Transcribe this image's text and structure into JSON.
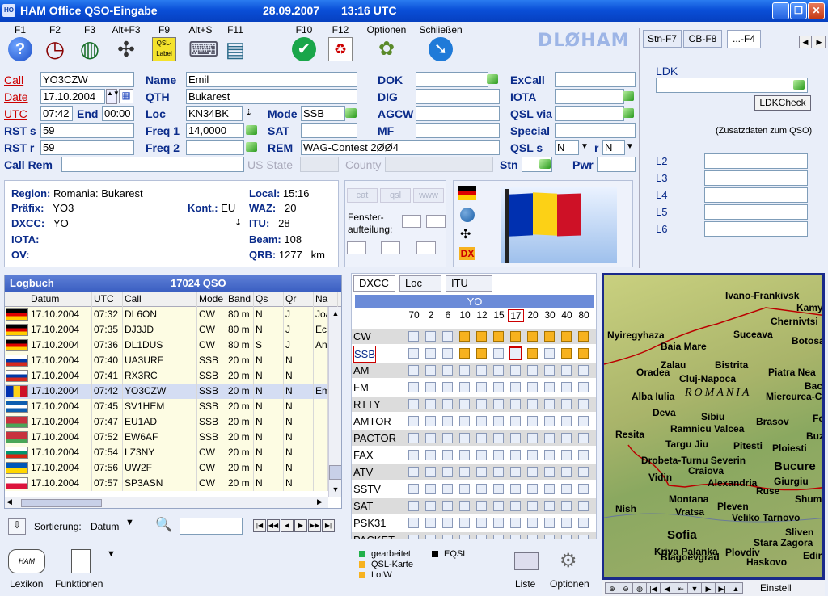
{
  "window": {
    "title": "HAM Office  QSO-Eingabe",
    "date": "28.09.2007",
    "time": "13:16 UTC"
  },
  "toolbar": [
    {
      "key": "F1",
      "icon": "help-icon"
    },
    {
      "key": "F2",
      "icon": "clock-icon"
    },
    {
      "key": "F3",
      "icon": "globe-icon"
    },
    {
      "key": "Alt+F3",
      "icon": "satellite-icon"
    },
    {
      "key": "F9",
      "icon": "qsl-label-icon",
      "text": "QSL-Label"
    },
    {
      "key": "Alt+S",
      "icon": "keyboard-icon"
    },
    {
      "key": "F11",
      "icon": "log-icon"
    },
    {
      "key": "F10",
      "icon": "check-icon"
    },
    {
      "key": "F12",
      "icon": "recycle-icon"
    },
    {
      "key": "Optionen",
      "icon": "options-icon"
    },
    {
      "key": "Schließen",
      "icon": "close-arrow-icon"
    }
  ],
  "station_call": "DLØHAM",
  "form": {
    "call_label": "Call",
    "call": "YO3CZW",
    "date_label": "Date",
    "date": "17.10.2004",
    "utc_label": "UTC",
    "utc": "07:42",
    "end_label": "End",
    "end": "00:00",
    "rsts_label": "RST s",
    "rsts": "59",
    "rstr_label": "RST r",
    "rstr": "59",
    "callrem_label": "Call Rem",
    "callrem": "",
    "name_label": "Name",
    "name": "Emil",
    "qth_label": "QTH",
    "qth": "Bukarest",
    "loc_label": "Loc",
    "loc": "KN34BK",
    "freq1_label": "Freq 1",
    "freq1": "14,0000",
    "freq2_label": "Freq 2",
    "freq2": "",
    "mode_label": "Mode",
    "mode": "SSB",
    "sat_label": "SAT",
    "sat": "",
    "rem_label": "REM",
    "rem": "WAG-Contest 2ØØ4",
    "usstate_label": "US State",
    "county_label": "County",
    "dok_label": "DOK",
    "dok": "",
    "dig_label": "DIG",
    "dig": "",
    "agcw_label": "AGCW",
    "agcw": "",
    "mf_label": "MF",
    "mf": "",
    "excall_label": "ExCall",
    "excall": "",
    "iota_label": "IOTA",
    "iota": "",
    "qslvia_label": "QSL via",
    "qslvia": "",
    "special_label": "Special",
    "special": "",
    "qsls_label": "QSL s",
    "qsls": "N",
    "r_label": "r",
    "qslr": "N",
    "stn_label": "Stn",
    "pwr_label": "Pwr",
    "pwr": ""
  },
  "rpanel": {
    "tabs": [
      "Stn-F7",
      "CB-F8",
      "...-F4"
    ],
    "ldk_label": "LDK",
    "ldk_button": "LDKCheck",
    "note": "(Zusatzdaten zum QSO)",
    "lines": [
      "L2",
      "L3",
      "L4",
      "L5",
      "L6"
    ]
  },
  "info": {
    "region_label": "Region:",
    "region": "Romania: Bukarest",
    "prefix_label": "Präfix:",
    "prefix": "YO3",
    "kont_label": "Kont.:",
    "kont": "EU",
    "dxcc_label": "DXCC:",
    "dxcc": "YO",
    "iota_label": "IOTA:",
    "ov_label": "OV:",
    "local_label": "Local:",
    "local": "15:16",
    "waz_label": "WAZ:",
    "waz": "20",
    "itu_label": "ITU:",
    "itu": "28",
    "beam_label": "Beam:",
    "beam": "108",
    "qrb_label": "QRB:",
    "qrb": "1277",
    "qrb_unit": "km"
  },
  "mid": {
    "btns": [
      "cat",
      "qsl",
      "www"
    ],
    "fenster": "Fenster-aufteilung:"
  },
  "logbook": {
    "title": "Logbuch",
    "count": "17024 QSO",
    "cols": [
      "Datum",
      "UTC",
      "Call",
      "Mode",
      "Band",
      "Qs",
      "Qr",
      "Na"
    ],
    "rows": [
      {
        "flag": "de",
        "d": "17.10.2004",
        "u": "07:32",
        "c": "DL6ON",
        "m": "CW",
        "b": "80 m",
        "qs": "N",
        "qr": "J",
        "n": "Joa"
      },
      {
        "flag": "de",
        "d": "17.10.2004",
        "u": "07:35",
        "c": "DJ3JD",
        "m": "CW",
        "b": "80 m",
        "qs": "N",
        "qr": "J",
        "n": "Eck"
      },
      {
        "flag": "de",
        "d": "17.10.2004",
        "u": "07:36",
        "c": "DL1DUS",
        "m": "CW",
        "b": "80 m",
        "qs": "S",
        "qr": "J",
        "n": "And"
      },
      {
        "flag": "ru",
        "d": "17.10.2004",
        "u": "07:40",
        "c": "UA3URF",
        "m": "SSB",
        "b": "20 m",
        "qs": "N",
        "qr": "N",
        "n": ""
      },
      {
        "flag": "ru",
        "d": "17.10.2004",
        "u": "07:41",
        "c": "RX3RC",
        "m": "SSB",
        "b": "20 m",
        "qs": "N",
        "qr": "N",
        "n": ""
      },
      {
        "flag": "ro",
        "d": "17.10.2004",
        "u": "07:42",
        "c": "YO3CZW",
        "m": "SSB",
        "b": "20 m",
        "qs": "N",
        "qr": "N",
        "n": "Em"
      },
      {
        "flag": "gr",
        "d": "17.10.2004",
        "u": "07:45",
        "c": "SV1HEM",
        "m": "SSB",
        "b": "20 m",
        "qs": "N",
        "qr": "N",
        "n": ""
      },
      {
        "flag": "by",
        "d": "17.10.2004",
        "u": "07:47",
        "c": "EU1AD",
        "m": "SSB",
        "b": "20 m",
        "qs": "N",
        "qr": "N",
        "n": ""
      },
      {
        "flag": "by",
        "d": "17.10.2004",
        "u": "07:52",
        "c": "EW6AF",
        "m": "SSB",
        "b": "20 m",
        "qs": "N",
        "qr": "N",
        "n": ""
      },
      {
        "flag": "bg",
        "d": "17.10.2004",
        "u": "07:54",
        "c": "LZ3NY",
        "m": "CW",
        "b": "20 m",
        "qs": "N",
        "qr": "N",
        "n": ""
      },
      {
        "flag": "ua",
        "d": "17.10.2004",
        "u": "07:56",
        "c": "UW2F",
        "m": "CW",
        "b": "20 m",
        "qs": "N",
        "qr": "N",
        "n": ""
      },
      {
        "flag": "pl",
        "d": "17.10.2004",
        "u": "07:57",
        "c": "SP3ASN",
        "m": "CW",
        "b": "20 m",
        "qs": "N",
        "qr": "N",
        "n": ""
      }
    ],
    "sort_label": "Sortierung:",
    "sort": "Datum"
  },
  "bottom": {
    "lexikon": "Lexikon",
    "funktionen": "Funktionen",
    "liste": "Liste",
    "optionen": "Optionen"
  },
  "dxcc": {
    "tabs": [
      "DXCC",
      "Loc",
      "ITU"
    ],
    "title": "YO",
    "bands": [
      "70",
      "2",
      "6",
      "10",
      "12",
      "15",
      "17",
      "20",
      "30",
      "40",
      "80"
    ],
    "modes": [
      "CW",
      "SSB",
      "AM",
      "FM",
      "RTTY",
      "AMTOR",
      "PACTOR",
      "FAX",
      "ATV",
      "SSTV",
      "SAT",
      "PSK31",
      "PACKET"
    ],
    "worked": {
      "CW": [
        3,
        4,
        5,
        6,
        7,
        8,
        9,
        10
      ],
      "SSB": [
        3,
        4,
        7,
        9,
        10
      ]
    },
    "selected": {
      "mode": "SSB",
      "band": 6
    },
    "legend": [
      {
        "t": "gearbeitet",
        "c": "#22b04a"
      },
      {
        "t": "QSL-Karte",
        "c": "#f7b21f"
      },
      {
        "t": "LotW",
        "c": "#f7b21f"
      },
      {
        "t": "EQSL",
        "c": "#000000"
      }
    ]
  },
  "map": {
    "cities": [
      "Ivano-Frankivsk",
      "Kamy",
      "Chernivtsi",
      "Nyiregyhaza",
      "Suceava",
      "Botosa",
      "Baia Mare",
      "Bistrita",
      "Zalau",
      "Oradea",
      "Cluj-Napoca",
      "Piatra Nea",
      "Alba Iulia",
      "ROMANIA",
      "Bac",
      "Miercurea-C",
      "Deva",
      "Sibiu",
      "Brasov",
      "Foc",
      "Resita",
      "Ramnicu Valcea",
      "Targu Jiu",
      "Pitesti",
      "Ploiesti",
      "Buz",
      "Drobeta-Turnu Severin",
      "Craiova",
      "Bucure",
      "Vidin",
      "Alexandria",
      "Giurgiu",
      "Ruse",
      "Montana",
      "Pleven",
      "Shum",
      "Nish",
      "Vratsa",
      "Veliko Tarnovo",
      "Sofia",
      "Sliven",
      "Stara Zagora",
      "Kriva Palanka",
      "Plovdiv",
      "Blagoevgrad",
      "Haskovo",
      "Edirn"
    ],
    "bottom_label": "Einstell"
  }
}
